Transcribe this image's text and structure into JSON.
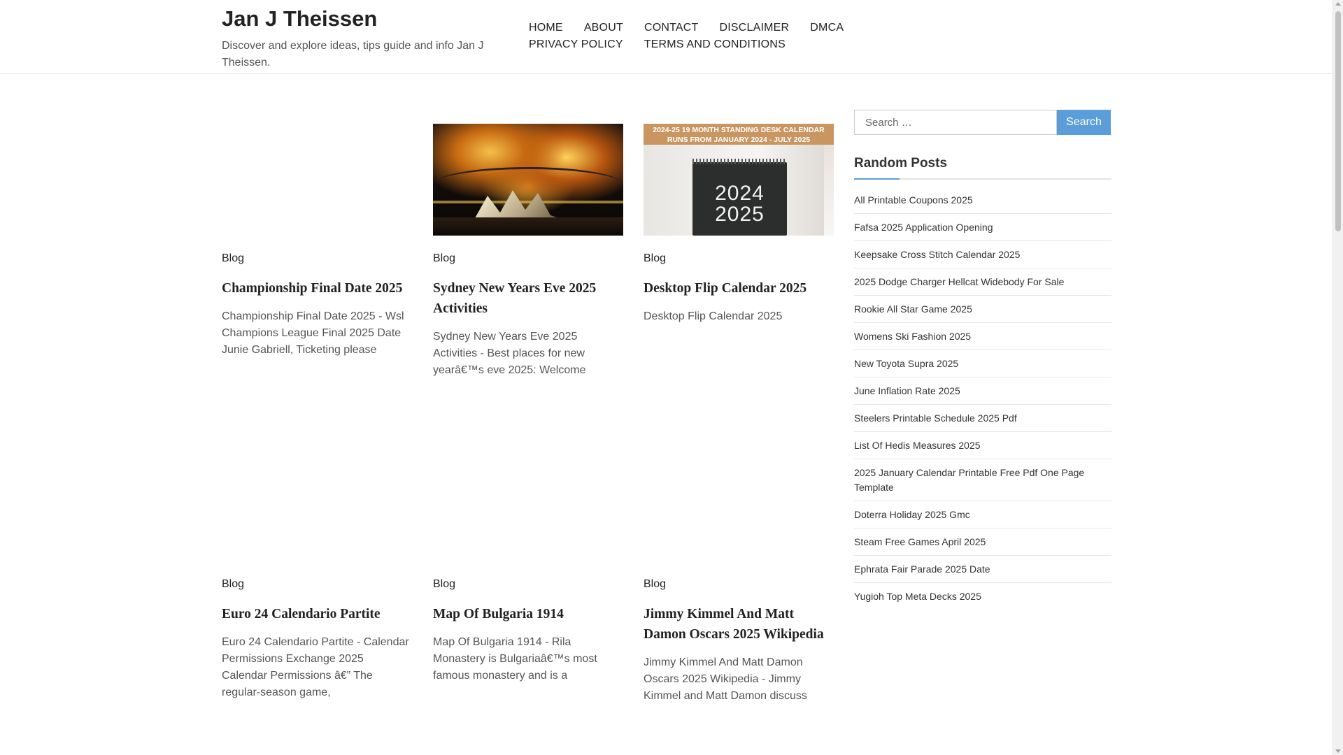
{
  "header": {
    "site_title": "Jan J Theissen",
    "site_description": "Discover and explore ideas, tips guide and info Jan J Theissen."
  },
  "nav": {
    "items": [
      {
        "label": "HOME"
      },
      {
        "label": "ABOUT"
      },
      {
        "label": "CONTACT"
      },
      {
        "label": "DISCLAIMER"
      },
      {
        "label": "DMCA"
      },
      {
        "label": "PRIVACY POLICY"
      },
      {
        "label": "TERMS AND CONDITIONS"
      }
    ]
  },
  "posts": [
    {
      "category": "Blog",
      "title": "Championship Final Date 2025",
      "excerpt": "Championship Final Date 2025 - Wsl Champions League Final 2025 Date Junie Gabriell, Ticketing please",
      "thumbnail": "none"
    },
    {
      "category": "Blog",
      "title": "Sydney New Years Eve 2025 Activities",
      "excerpt": "Sydney New Years Eve 2025 Activities - Best places for new yearâ€™s eve 2025: Welcome",
      "thumbnail": "fireworks-image"
    },
    {
      "category": "Blog",
      "title": "Desktop Flip Calendar 2025",
      "excerpt": "Desktop Flip Calendar 2025",
      "thumbnail": "calendar-image",
      "image_banner": "2024-25 19 MONTH STANDING DESK CALENDAR RUNS FROM JANUARY 2024 - JULY 2025",
      "image_text_1": "2024",
      "image_text_2": "2025"
    },
    {
      "category": "Blog",
      "title": "Euro 24 Calendario Partite",
      "excerpt": "Euro 24 Calendario Partite - Calendar Permissions Exchange 2025 Calendar Permissions â€” The regular-season game,",
      "thumbnail": "none"
    },
    {
      "category": "Blog",
      "title": "Map Of Bulgaria 1914",
      "excerpt": "Map Of Bulgaria 1914 - Rila Monastery is Bulgariaâ€™s most famous monastery and is a",
      "thumbnail": "none"
    },
    {
      "category": "Blog",
      "title": "Jimmy Kimmel And Matt Damon Oscars 2025 Wikipedia",
      "excerpt": "Jimmy Kimmel And Matt Damon Oscars 2025 Wikipedia - Jimmy Kimmel and Matt Damon discuss",
      "thumbnail": "none"
    }
  ],
  "sidebar": {
    "search_placeholder": "Search …",
    "search_button": "Search",
    "widget_title": "Random Posts",
    "random_posts": [
      "All Printable Coupons 2025",
      "Fafsa 2025 Application Opening",
      "Keepsake Cross Stitch Calendar 2025",
      "2025 Dodge Charger Hellcat Widebody For Sale",
      "Rookie All Star Game 2025",
      "Womens Ski Fashion 2025",
      "New Toyota Supra 2025",
      "June Inflation Rate 2025",
      "Steelers Printable Schedule 2025 Pdf",
      "List Of Hedis Measures 2025",
      "2025 January Calendar Printable Free Pdf One Page Template",
      "Doterra Holiday 2025 Gmc",
      "Steam Free Games April 2025",
      "Ephrata Fair Parade 2025 Date",
      "Yugioh Top Meta Decks 2025"
    ]
  },
  "colors": {
    "accent": "#5b9dd9",
    "text": "#333333",
    "border": "#e6e6e6"
  }
}
